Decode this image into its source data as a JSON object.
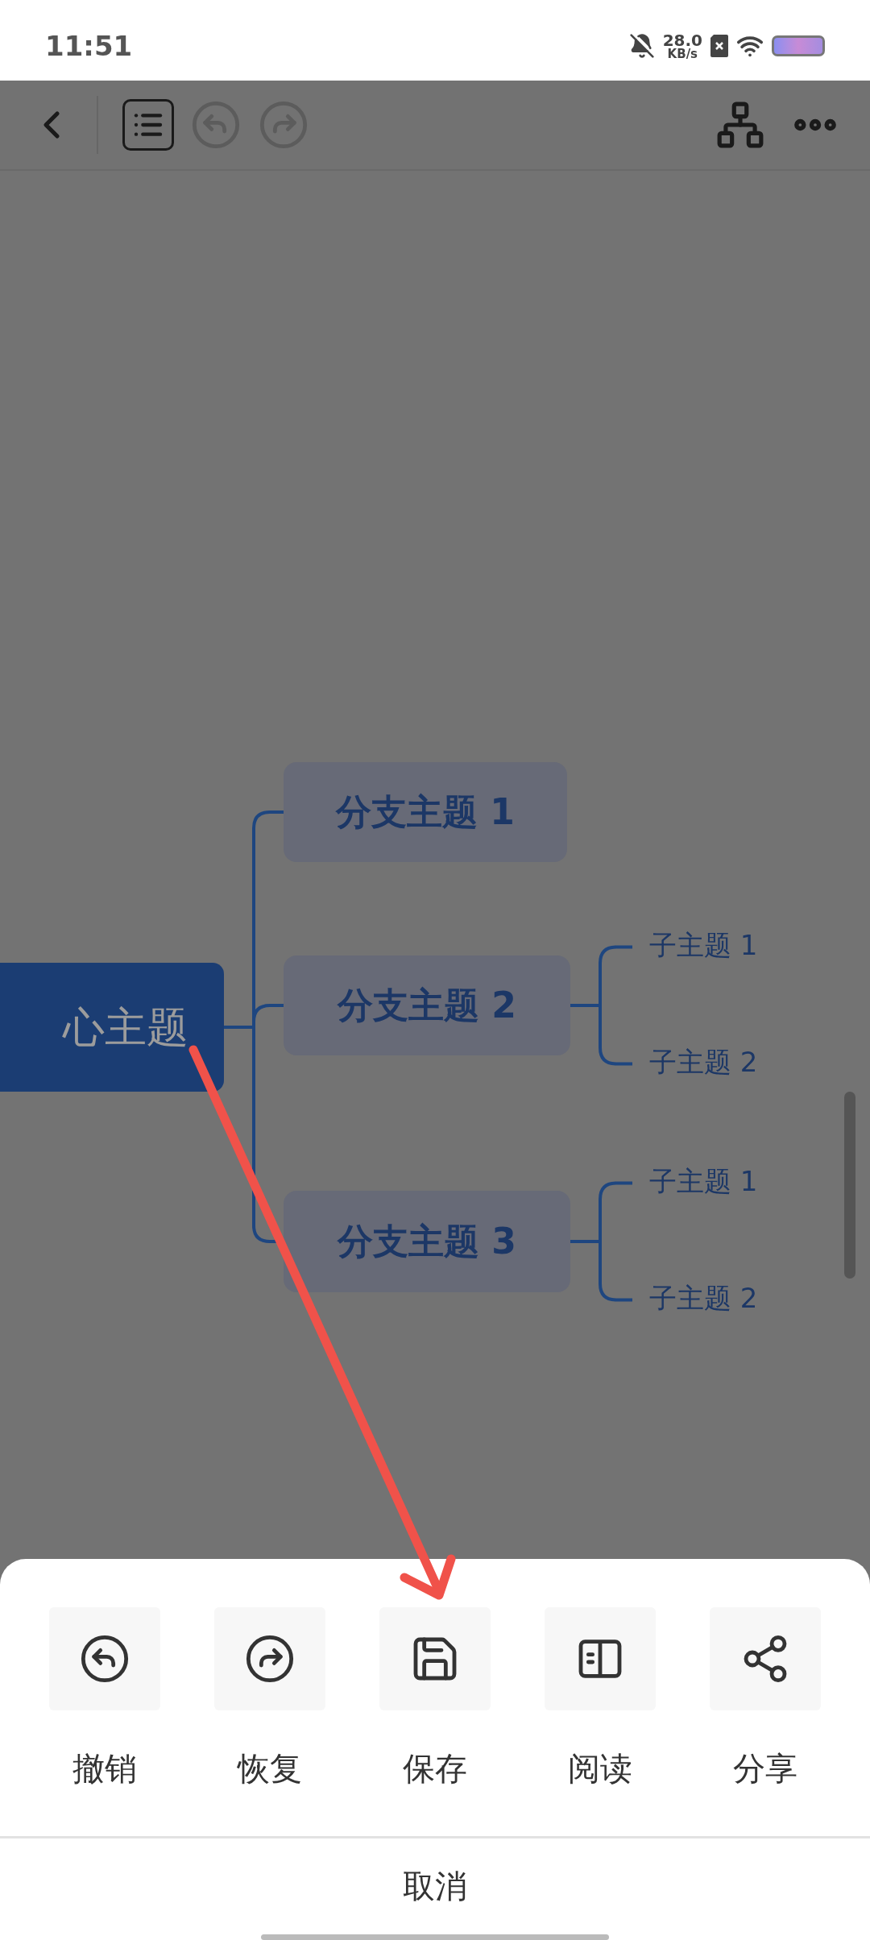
{
  "status_bar": {
    "time": "11:51",
    "net_speed": "28.0",
    "net_unit": "KB/s"
  },
  "toolbar": {
    "undo_disabled": true,
    "redo_disabled": true
  },
  "mind_map": {
    "central": "心主题",
    "branches": [
      {
        "label": "分支主题 1"
      },
      {
        "label": "分支主题 2",
        "children": [
          {
            "label": "子主题 1"
          },
          {
            "label": "子主题 2"
          }
        ]
      },
      {
        "label": "分支主题 3",
        "children": [
          {
            "label": "子主题 1"
          },
          {
            "label": "子主题 2"
          }
        ]
      }
    ]
  },
  "action_sheet": {
    "actions": [
      {
        "kind": "undo",
        "label": "撤销"
      },
      {
        "kind": "redo",
        "label": "恢复"
      },
      {
        "kind": "save",
        "label": "保存"
      },
      {
        "kind": "read",
        "label": "阅读"
      },
      {
        "kind": "share",
        "label": "分享"
      }
    ],
    "cancel": "取消"
  }
}
